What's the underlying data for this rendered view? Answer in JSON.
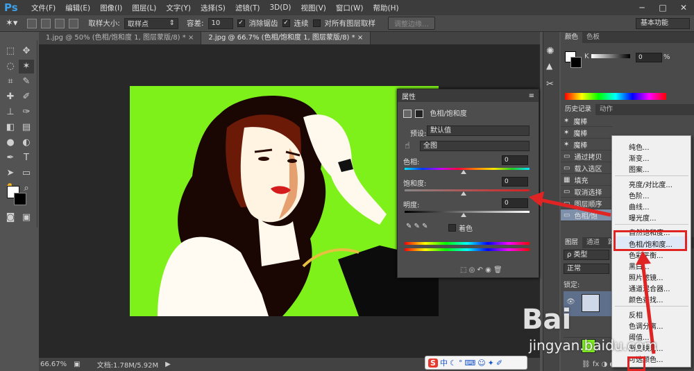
{
  "app": {
    "logo": "Ps"
  },
  "menubar": {
    "items": [
      "文件(F)",
      "编辑(E)",
      "图像(I)",
      "图层(L)",
      "文字(Y)",
      "选择(S)",
      "滤镜(T)",
      "3D(D)",
      "视图(V)",
      "窗口(W)",
      "帮助(H)"
    ],
    "min": "─",
    "max": "□",
    "close": "✕"
  },
  "options": {
    "sample_size_label": "取样大小:",
    "sample_size_value": "取样点",
    "tolerance_label": "容差:",
    "tolerance_value": "10",
    "antialias_label": "消除锯齿",
    "contiguous_label": "连续",
    "sample_all_label": "对所有图层取样",
    "refine_edge_label": "调整边缘...",
    "workspace": "基本功能"
  },
  "tabs": [
    {
      "label": "1.jpg @ 50% (色相/饱和度 1, 图层蒙版/8) *",
      "close": "×"
    },
    {
      "label": "2.jpg @ 66.7% (色相/饱和度 1, 图层蒙版/8) *",
      "close": "×"
    }
  ],
  "status": {
    "zoom": "66.67%",
    "doc": "文档:1.78M/5.92M"
  },
  "properties": {
    "title": "属性",
    "adjustment": "色相/饱和度",
    "preset_label": "预设:",
    "preset_value": "默认值",
    "channel_value": "全图",
    "hue_label": "色相:",
    "hue_value": "0",
    "sat_label": "饱和度:",
    "sat_value": "0",
    "light_label": "明度:",
    "light_value": "0",
    "colorize_label": "着色"
  },
  "color_panel": {
    "tab1": "颜色",
    "tab2": "色板",
    "k_label": "K",
    "k_value": "0",
    "percent": "%"
  },
  "history_panel": {
    "tab1": "历史记录",
    "tab2": "动作",
    "items": [
      "魔棒",
      "魔棒",
      "魔棒",
      "通过拷贝",
      "载入选区",
      "填充",
      "取消选择",
      "图层顺序",
      "色相/饱"
    ]
  },
  "layers_panel": {
    "tab1": "图层",
    "tab2": "通道",
    "tab3": "路径",
    "filter": "ρ 类型",
    "blend": "正常",
    "lock_label": "锁定:"
  },
  "context_menu": {
    "items": [
      "纯色...",
      "渐变...",
      "图案...",
      "亮度/对比度...",
      "色阶...",
      "曲线...",
      "曝光度...",
      "自然饱和度...",
      "色相/饱和度...",
      "色彩平衡...",
      "黑白...",
      "照片滤镜...",
      "通道混合器...",
      "颜色查找...",
      "反相",
      "色调分离...",
      "阈值...",
      "渐变映射...",
      "可选颜色..."
    ]
  },
  "ime": {
    "icon": "S",
    "lang": "中"
  },
  "watermark": {
    "line1": "Bai",
    "line2": "jingyan.baidu.com"
  },
  "colors": {
    "canvas_bg": "#7ef11b",
    "highlight": "#e02424",
    "menu_selected": "#4f6fa3"
  }
}
